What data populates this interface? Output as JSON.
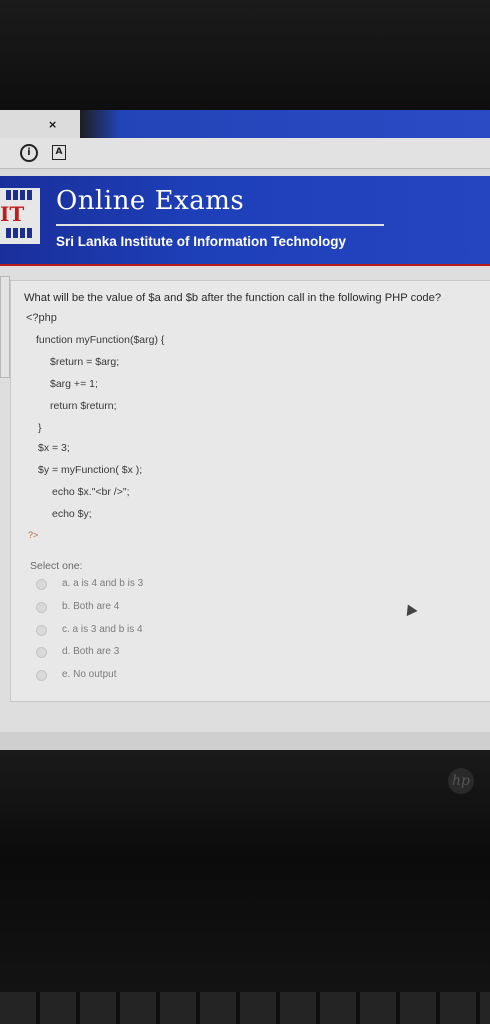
{
  "browser": {
    "tab_close": "×",
    "info_icon": "i",
    "page_icon": "A"
  },
  "header": {
    "title": "Online Exams",
    "subtitle": "Sri Lanka Institute of Information Technology",
    "logo_text": "IT"
  },
  "question": {
    "text": "What will be the value of $a and $b after the function call in the following PHP code?",
    "code_lines": [
      "<?php",
      "function myFunction($arg) {",
      "$return = $arg;",
      "$arg += 1;",
      "return $return;",
      "}",
      "$x = 3;",
      "$y = myFunction( $x );",
      "echo $x.\"<br />\";",
      "echo $y;",
      "?>"
    ]
  },
  "answer": {
    "select_label": "Select one:",
    "options": [
      "a. a is 4 and b is 3",
      "b. Both are 4",
      "c. a is 3 and b is 4",
      "d. Both are 3",
      "e. No output"
    ]
  },
  "device": {
    "brand_icon": "hp"
  }
}
